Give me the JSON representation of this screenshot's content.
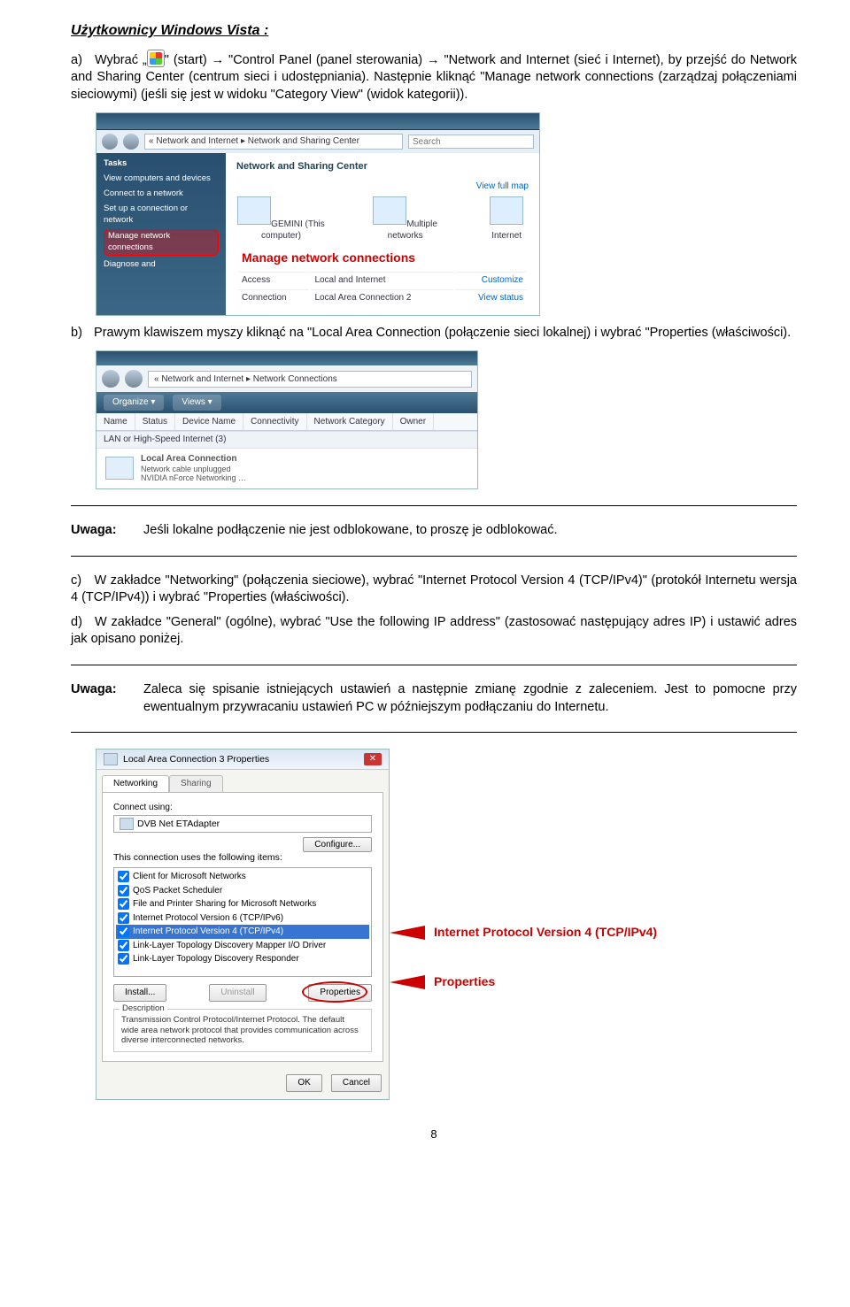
{
  "title": "Użytkownicy Windows Vista :",
  "step_a": {
    "letter": "a)",
    "t1": "Wybrać „",
    "t2": "\" (start) → \"Control Panel (panel sterowania) → \"Network and Internet (sieć i Internet), by przejść do Network and Sharing Center (centrum sieci i udostępniania). Następnie kliknąć \"Manage network connections (zarządzaj połączeniami sieciowymi) (jeśli się jest w widoku \"Category View\" (widok kategorii))."
  },
  "shot1": {
    "addr": "« Network and Internet ▸ Network and Sharing Center",
    "search_ph": "Search",
    "tasks": "Tasks",
    "side": [
      "View computers and devices",
      "Connect to a network",
      "Set up a connection or network",
      "Manage network connections",
      "Diagnose and"
    ],
    "hl_idx": 3,
    "mainTitle": "Network and Sharing Center",
    "fullmap": "View full map",
    "icons": [
      "GEMINI\n(This computer)",
      "Multiple networks",
      "Internet"
    ],
    "callout": "Manage network connections",
    "rows": [
      [
        "Access",
        "Local and Internet",
        "Customize"
      ],
      [
        "Connection",
        "Local Area Connection 2",
        "View status"
      ]
    ]
  },
  "step_b": {
    "letter": "b)",
    "text": "Prawym klawiszem myszy kliknąć na \"Local Area Connection (połączenie sieci lokalnej) i wybrać \"Properties (właściwości)."
  },
  "shot2": {
    "addr": "« Network and Internet ▸ Network Connections",
    "org": "Organize ▾",
    "views": "Views ▾",
    "cols": [
      "Name",
      "Status",
      "Device Name",
      "Connectivity",
      "Network Category",
      "Owner"
    ],
    "cat": "LAN or High-Speed Internet (3)",
    "item": "Local Area Connection",
    "sub1": "Network cable unplugged",
    "sub2": "NVIDIA nForce Networking …"
  },
  "uwaga1": {
    "lab": "Uwaga:",
    "txt": "Jeśli lokalne podłączenie nie jest odblokowane, to proszę je odblokować."
  },
  "step_c": {
    "letter": "c)",
    "text": "W zakładce \"Networking\" (połączenia sieciowe), wybrać \"Internet Protocol Version 4 (TCP/IPv4)\" (protokół Internetu wersja 4 (TCP/IPv4)) i wybrać \"Properties (właściwości)."
  },
  "step_d": {
    "letter": "d)",
    "text": "W zakładce \"General\" (ogólne), wybrać \"Use the following IP address\" (zastosować następujący adres IP) i ustawić adres jak opisano poniżej."
  },
  "uwaga2": {
    "lab": "Uwaga:",
    "txt": "Zaleca się spisanie istniejących ustawień a następnie zmianę zgodnie z zaleceniem. Jest to pomocne przy ewentualnym przywracaniu ustawień PC w późniejszym podłączaniu do Internetu."
  },
  "shot3": {
    "title": "Local Area Connection 3 Properties",
    "tabs": [
      "Networking",
      "Sharing"
    ],
    "connectUsing": "Connect using:",
    "adapter": "DVB Net ETAdapter",
    "configure": "Configure...",
    "usesItems": "This connection uses the following items:",
    "items": [
      "Client for Microsoft Networks",
      "QoS Packet Scheduler",
      "File and Printer Sharing for Microsoft Networks",
      "Internet Protocol Version 6 (TCP/IPv6)",
      "Internet Protocol Version 4 (TCP/IPv4)",
      "Link-Layer Topology Discovery Mapper I/O Driver",
      "Link-Layer Topology Discovery Responder"
    ],
    "sel_idx": 4,
    "install": "Install...",
    "uninstall": "Uninstall",
    "properties": "Properties",
    "descLab": "Description",
    "desc": "Transmission Control Protocol/Internet Protocol. The default wide area network protocol that provides communication across diverse interconnected networks.",
    "ok": "OK",
    "cancel": "Cancel",
    "annot1": "Internet Protocol Version 4 (TCP/IPv4)",
    "annot2": "Properties"
  },
  "page": "8"
}
